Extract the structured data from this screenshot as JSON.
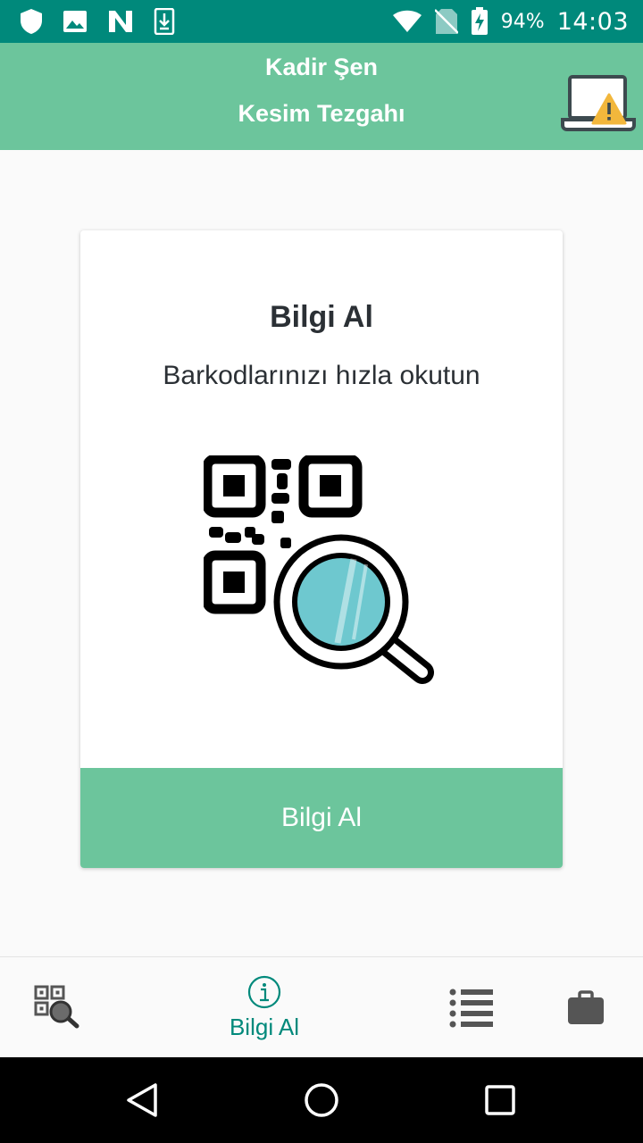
{
  "status_bar": {
    "battery_percent": "94%",
    "time": "14:03"
  },
  "app_bar": {
    "user_name": "Kadir Şen",
    "station_name": "Kesim Tezgahı"
  },
  "card": {
    "title": "Bilgi Al",
    "subtitle": "Barkodlarınızı hızla okutun",
    "button_label": "Bilgi Al"
  },
  "bottom_nav": {
    "items": [
      {
        "icon": "qr-search-icon",
        "label": ""
      },
      {
        "icon": "info-icon",
        "label": "Bilgi Al",
        "active": true
      },
      {
        "icon": "list-icon",
        "label": ""
      },
      {
        "icon": "briefcase-icon",
        "label": ""
      }
    ]
  },
  "colors": {
    "status_bar": "#00897b",
    "app_bar": "#6cc59c",
    "accent": "#00897b"
  }
}
